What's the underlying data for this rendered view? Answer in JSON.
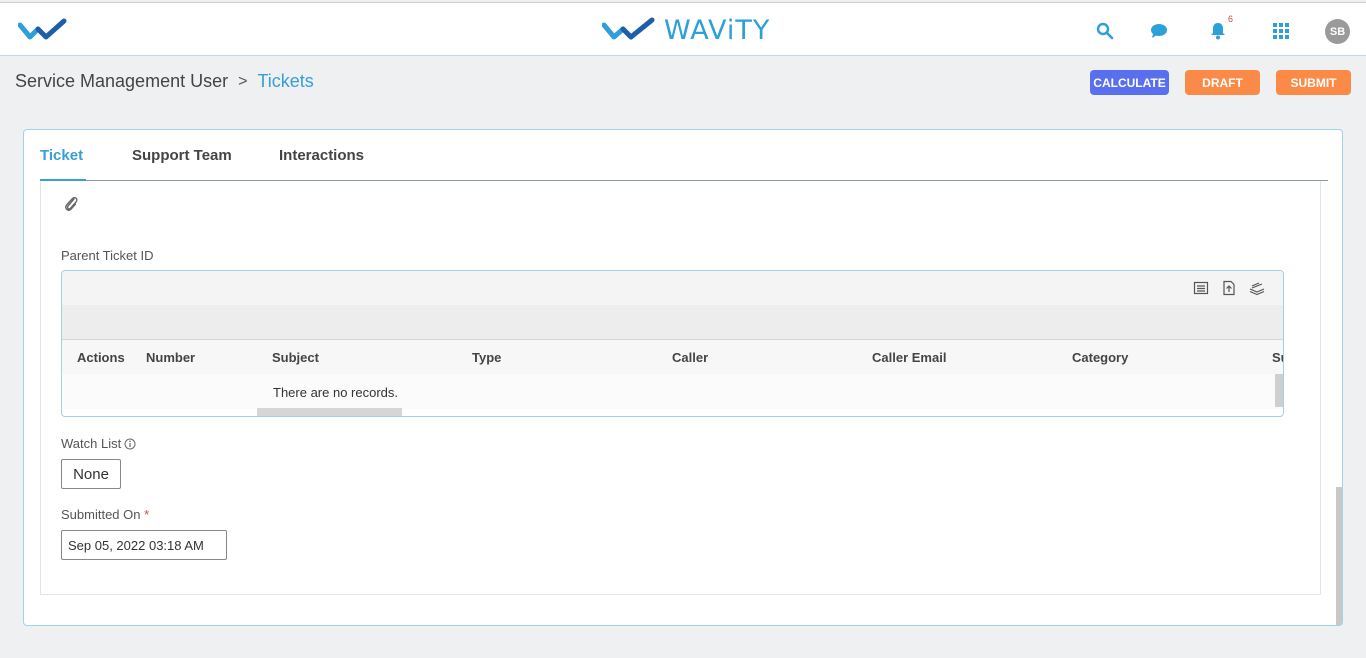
{
  "app": {
    "brand": "WAViTY",
    "notification_count": "6",
    "user_initials": "SB"
  },
  "breadcrumb": {
    "parent": "Service Management User",
    "separator": ">",
    "current": "Tickets"
  },
  "actions": {
    "calculate": "CALCULATE",
    "draft": "DRAFT",
    "submit": "SUBMIT"
  },
  "tabs": [
    {
      "label": "Ticket",
      "active": true
    },
    {
      "label": "Support Team",
      "active": false
    },
    {
      "label": "Interactions",
      "active": false
    }
  ],
  "form": {
    "parent_ticket_label": "Parent Ticket ID",
    "grid": {
      "columns": [
        "Actions",
        "Number",
        "Subject",
        "Type",
        "Caller",
        "Caller Email",
        "Category",
        "Su"
      ],
      "empty_message": "There are no records."
    },
    "watch_list_label": "Watch List",
    "watch_list_value": "None",
    "submitted_on_label": "Submitted On",
    "required_mark": "*",
    "submitted_on_value": "Sep 05, 2022 03:18 AM"
  },
  "colors": {
    "accent": "#3a9dd6",
    "calculate": "#5a6ff0",
    "draft": "#fb8a46",
    "submit": "#fb8a46"
  }
}
